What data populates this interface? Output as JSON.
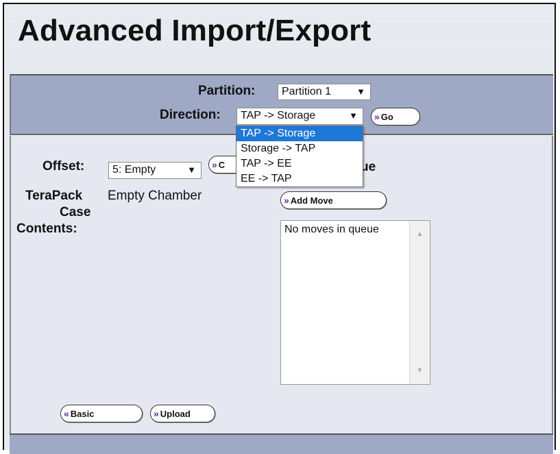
{
  "page": {
    "title": "Advanced Import/Export"
  },
  "partition": {
    "label": "Partition:",
    "value": "Partition 1",
    "arrow": "▼"
  },
  "direction": {
    "label": "Direction:",
    "value": "TAP -> Storage",
    "arrow": "▼",
    "go_button": "Go",
    "options": [
      "TAP -> Storage",
      "Storage -> TAP",
      "TAP -> EE",
      "EE -> TAP"
    ],
    "selected_index": 0
  },
  "offset": {
    "label": "Offset:",
    "value": "5: Empty",
    "arrow": "▼",
    "button_partial": "C"
  },
  "queue": {
    "heading_partial": "ue",
    "add_move_button": "Add Move",
    "textarea_value": "No moves in queue"
  },
  "contents": {
    "label_line1": "TeraPack",
    "label_line2": "Case",
    "label_line3": "Contents:",
    "value": "Empty Chamber"
  },
  "buttons": {
    "basic": "Basic",
    "upload": "Upload"
  },
  "glyphs": {
    "forward": "»",
    "back": "«",
    "scroll_up": "▲",
    "scroll_down": "▼"
  },
  "colors": {
    "panel": "#9fa9c5",
    "main_bg": "#e6e8f1",
    "selected_option": "#1e78d6",
    "button_glyph": "#5b2b95"
  }
}
